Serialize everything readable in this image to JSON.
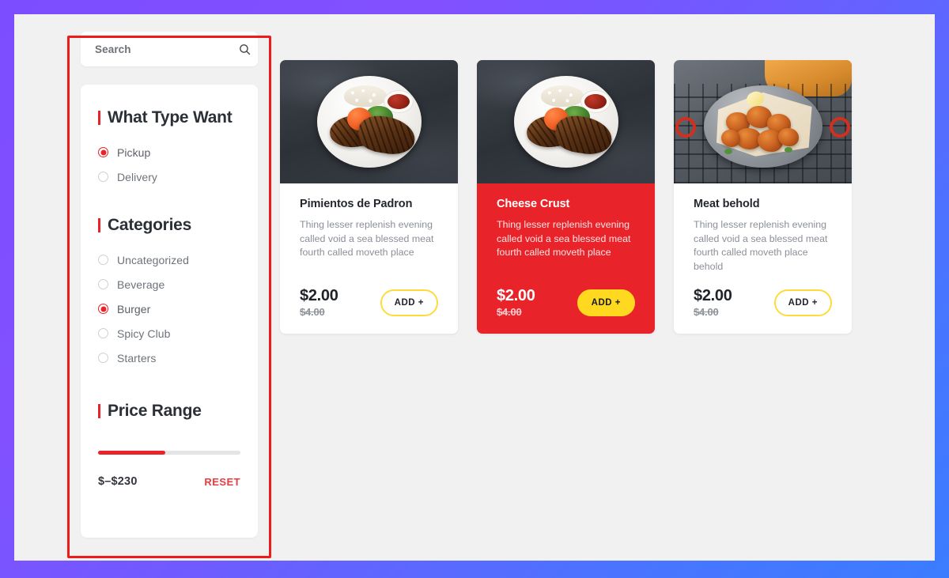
{
  "theme": {
    "frame_gradient_from": "#7b4dff",
    "frame_gradient_to": "#3b7cff",
    "page_background": "#f1f1f2",
    "accent_red": "#e8242a",
    "accent_yellow": "#ffd91f",
    "highlight_box": "#ee1b1b"
  },
  "sidebar": {
    "search": {
      "placeholder": "Search",
      "value": "",
      "icon": "search-icon"
    },
    "type_section": {
      "title": "What Type Want",
      "options": [
        {
          "label": "Pickup",
          "selected": true
        },
        {
          "label": "Delivery",
          "selected": false
        }
      ]
    },
    "categories_section": {
      "title": "Categories",
      "options": [
        {
          "label": "Uncategorized",
          "selected": false
        },
        {
          "label": "Beverage",
          "selected": false
        },
        {
          "label": "Burger",
          "selected": true
        },
        {
          "label": "Spicy Club",
          "selected": false
        },
        {
          "label": "Starters",
          "selected": false
        }
      ]
    },
    "price_section": {
      "title": "Price Range",
      "slider_fill_percent": 47,
      "range_label": "$–$230",
      "reset_label": "RESET"
    }
  },
  "products": [
    {
      "name": "Pimientos de Padron",
      "description": "Thing lesser replenish evening called void a sea blessed meat fourth called moveth place",
      "price": "$2.00",
      "old_price": "$4.00",
      "add_label": "ADD +",
      "featured": false,
      "photo": "grilled-meat-plate"
    },
    {
      "name": "Cheese Crust",
      "description": "Thing lesser replenish evening called void a sea blessed meat fourth called moveth place",
      "price": "$2.00",
      "old_price": "$4.00",
      "add_label": "ADD +",
      "featured": true,
      "photo": "grilled-meat-plate"
    },
    {
      "name": "Meat behold",
      "description": "Thing lesser replenish evening called void a sea blessed meat fourth called moveth place behold",
      "price": "$2.00",
      "old_price": "$4.00",
      "add_label": "ADD +",
      "featured": false,
      "photo": "fried-chicken-pan"
    }
  ]
}
